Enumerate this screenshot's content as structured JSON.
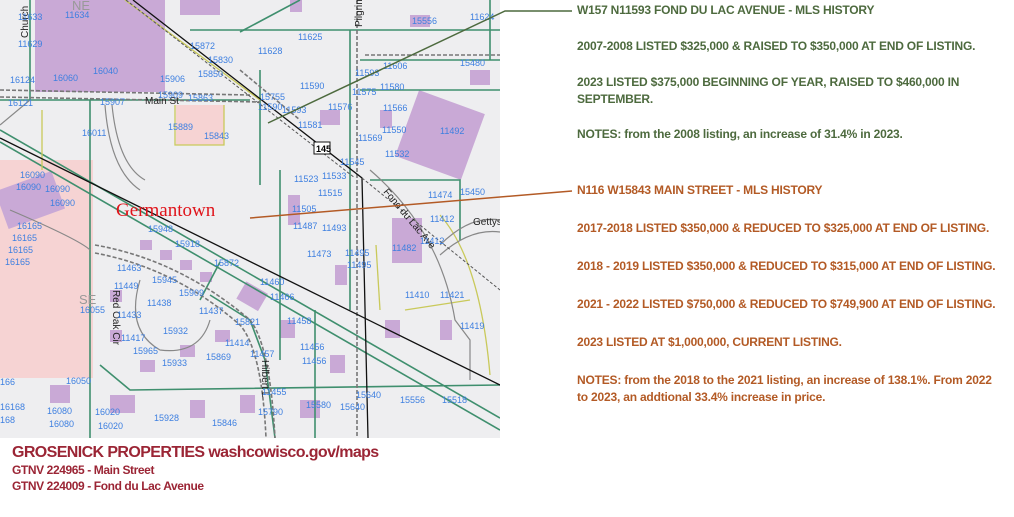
{
  "map": {
    "town_label": "Germantown",
    "highway_shield": "145",
    "street_labels": [
      "Main St",
      "Pilgrim",
      "Fond du Lac Ave",
      "Hilbert L",
      "Red Oak Cir",
      "SE",
      "NE",
      "Church",
      "Gettys"
    ],
    "parcel_labels": [
      "11634",
      "11633",
      "11629",
      "16124",
      "16060",
      "16040",
      "15906",
      "15872",
      "15830",
      "15850",
      "11628",
      "11625",
      "15909",
      "15863",
      "15907",
      "16121",
      "15755",
      "11590",
      "11593",
      "11606",
      "15480",
      "11575",
      "11580",
      "11576",
      "11566",
      "11593",
      "11581",
      "11550",
      "11492",
      "16011",
      "15889",
      "15843",
      "11532",
      "11523",
      "11533",
      "11515",
      "16090",
      "16090",
      "16090",
      "16090",
      "16165",
      "16165",
      "16165",
      "16165",
      "11474",
      "15948",
      "15918",
      "11505",
      "11487",
      "11493",
      "11482",
      "11412",
      "11473",
      "11495",
      "11495",
      "15872",
      "11463",
      "15945",
      "11449",
      "15909",
      "11460",
      "11466",
      "11410",
      "11421",
      "11438",
      "16055",
      "11433",
      "11437",
      "15821",
      "11458",
      "11419",
      "15932",
      "11417",
      "11414",
      "15965",
      "11456",
      "11456",
      "11457",
      "15869",
      "15933",
      "166",
      "16050",
      "11455",
      "15640",
      "15556",
      "15518",
      "16168",
      "16080",
      "16080",
      "16020",
      "16020",
      "15928",
      "15790",
      "15580",
      "15640",
      "15846",
      "168",
      "15556",
      "11624",
      "11569",
      "11545",
      "11590",
      "11412",
      "15450"
    ]
  },
  "notes_fond_du_lac": {
    "title": "W157 N11593 FOND DU LAC AVENUE - MLS HISTORY",
    "lines": [
      "2007-2008 LISTED $325,000 & RAISED TO $350,000 AT END OF LISTING.",
      "2023  LISTED $375,000 BEGINNING OF YEAR, RAISED TO $460,000 IN SEPTEMBER.",
      "NOTES:  from the 2008 listing, an increase of 31.4% in 2023."
    ]
  },
  "notes_main_street": {
    "title": "N116 W15843 MAIN STREET - MLS HISTORY",
    "lines": [
      "2017-2018 LISTED $350,000 & REDUCED TO $325,000 AT END OF LISTING.",
      "2018 - 2019 LISTED $350,000 & REDUCED TO $315,000 AT END OF LISTING.",
      "2021 - 2022 LISTED $750,000 & REDUCED TO $749,900 AT END OF LISTING.",
      "2023 LISTED AT $1,000,000, CURRENT LISTING.",
      "NOTES:  from the 2018 to the 2021 listing, an increase of 138.1%. From 2022 to 2023, an addtional 33.4% increase in price."
    ]
  },
  "footer": {
    "title": "GROSENICK PROPERTIES washcowisco.gov/maps",
    "line1": "GTNV 224965 -  Main Street",
    "line2": "GTNV 224009 -  Fond du Lac Avenue"
  },
  "colors": {
    "green_note": "#4d6a3e",
    "orange_note": "#b35a25",
    "footer_red": "#9b2535",
    "building": "#c9a9d6",
    "parcel_line": "#3f8f6e"
  }
}
